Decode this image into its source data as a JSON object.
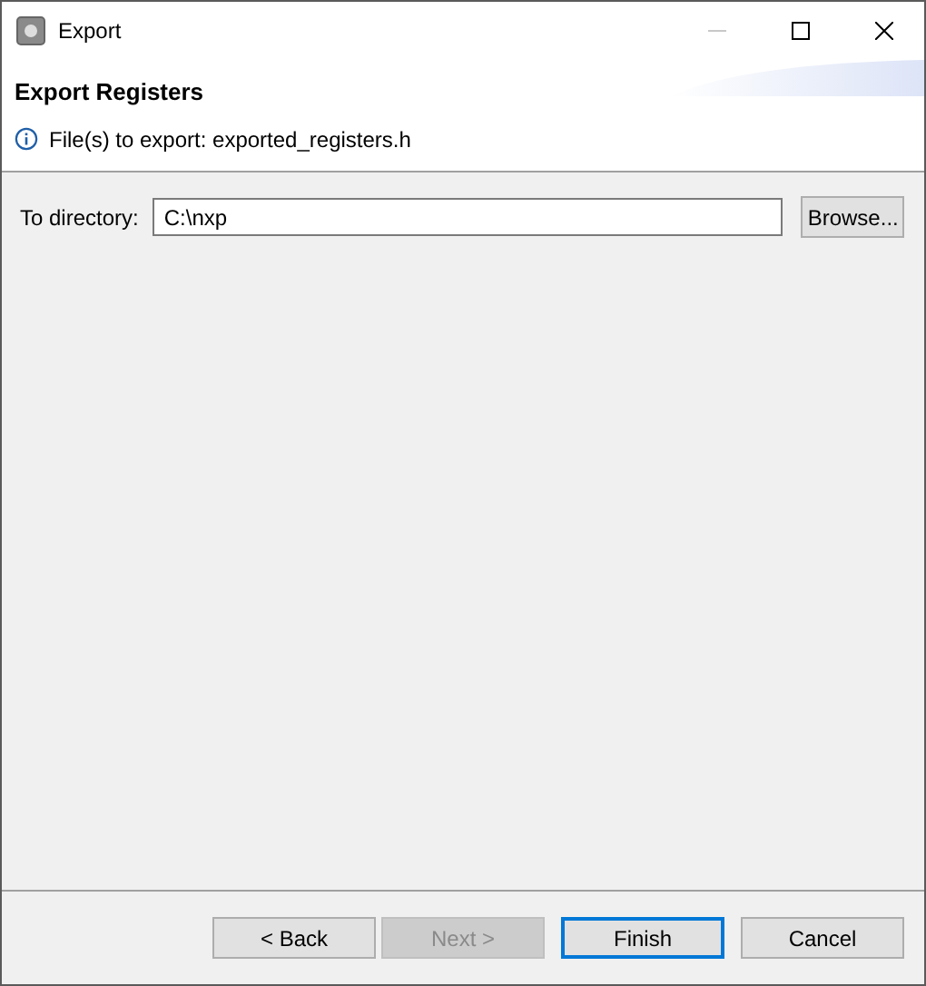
{
  "window": {
    "title": "Export"
  },
  "header": {
    "title": "Export Registers",
    "message": "File(s) to export: exported_registers.h"
  },
  "directory": {
    "label": "To directory:",
    "value": "C:\\nxp",
    "browse": "Browse..."
  },
  "buttons": [
    {
      "label": "< Back",
      "disabled": false,
      "default": false
    },
    {
      "label": "Next >",
      "disabled": true,
      "default": false
    },
    {
      "label": "Finish",
      "disabled": false,
      "default": true
    },
    {
      "label": "Cancel",
      "disabled": false,
      "default": false
    }
  ]
}
